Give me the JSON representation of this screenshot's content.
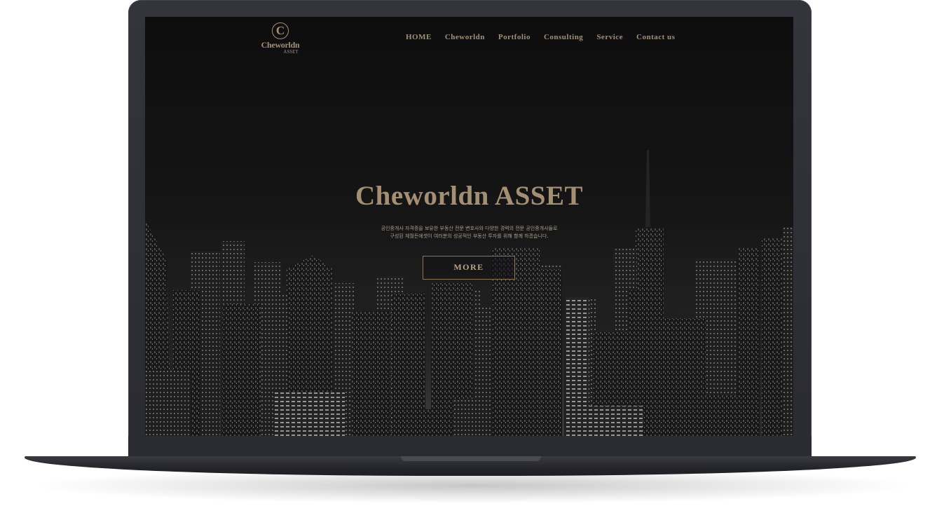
{
  "brand": {
    "mark": "C",
    "name": "Cheworldn",
    "sub": "ASSET"
  },
  "nav": {
    "items": [
      "HOME",
      "Cheworldn",
      "Portfolio",
      "Consulting",
      "Service",
      "Contact us"
    ]
  },
  "hero": {
    "title": "Cheworldn ASSET",
    "desc_line1": "공인중개사 자격증을 보유한 부동산 전문 변호사와 다양한 경력의 전문 공인중개사들로",
    "desc_line2": "구성된 체월든에셋이 여러분의 성공적인 부동산 투자를 위해 함께 하겠습니다.",
    "button_label": "MORE"
  },
  "colors": {
    "accent": "#a48f73",
    "background": "#121213",
    "device": "#2a2b31"
  }
}
